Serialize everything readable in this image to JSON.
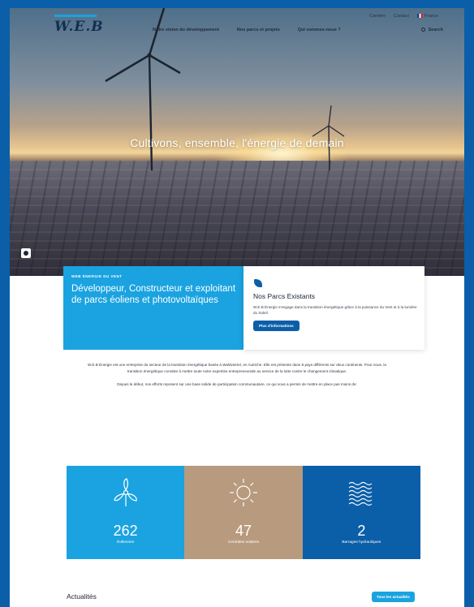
{
  "header": {
    "logo_text": "W.E.B",
    "top_links": [
      "Carrière",
      "Contact"
    ],
    "language": "France",
    "nav": [
      "Notre vision du développement",
      "Nos parcs et projets",
      "Qui sommes-nous ?"
    ],
    "search_label": "Search"
  },
  "hero": {
    "title": "Cultivons, ensemble, l'énergie de demain"
  },
  "card_left": {
    "eyebrow": "WEB ÉNERGIE DU VENT",
    "heading": "Développeur, Constructeur et exploitant de parcs éoliens et photovoltaïques"
  },
  "card_right": {
    "title": "Nos Parcs Existants",
    "description": "W.E.B Énergie s'engage dans la transition énergétique grâce à la puissance du Vent et à la lumière du Soleil.",
    "button": "Plus d'informations"
  },
  "intro": {
    "paragraph1": "W.E.B Énergie est une entreprise du secteur de la transition énergétique basée à Waldviertel, en Autriche. Elle est présente dans 8 pays différents sur deux continents. Pour nous, la transition énergétique consiste à mettre toute notre expertise entrepreneuriale au service de la lutte contre le changement climatique.",
    "paragraph2": "Depuis le début, nos efforts reposent sur une base solide de participation communautaire, ce qui nous a permis de mettre en place pas moins de:"
  },
  "stats": [
    {
      "value": "262",
      "label": "Éoliennes",
      "color": "#1aa3e0",
      "icon": "wind-turbine-icon"
    },
    {
      "value": "47",
      "label": "Centrales solaires",
      "color": "#b89a7e",
      "icon": "sun-icon"
    },
    {
      "value": "2",
      "label": "Barrages hydrauliques",
      "color": "#0b5ea8",
      "icon": "waves-icon"
    }
  ],
  "news": {
    "title": "Actualités",
    "button": "Tous les actualités"
  },
  "colors": {
    "brand_blue": "#0b5ea8",
    "accent_blue": "#1aa3e0",
    "sand": "#b89a7e"
  }
}
